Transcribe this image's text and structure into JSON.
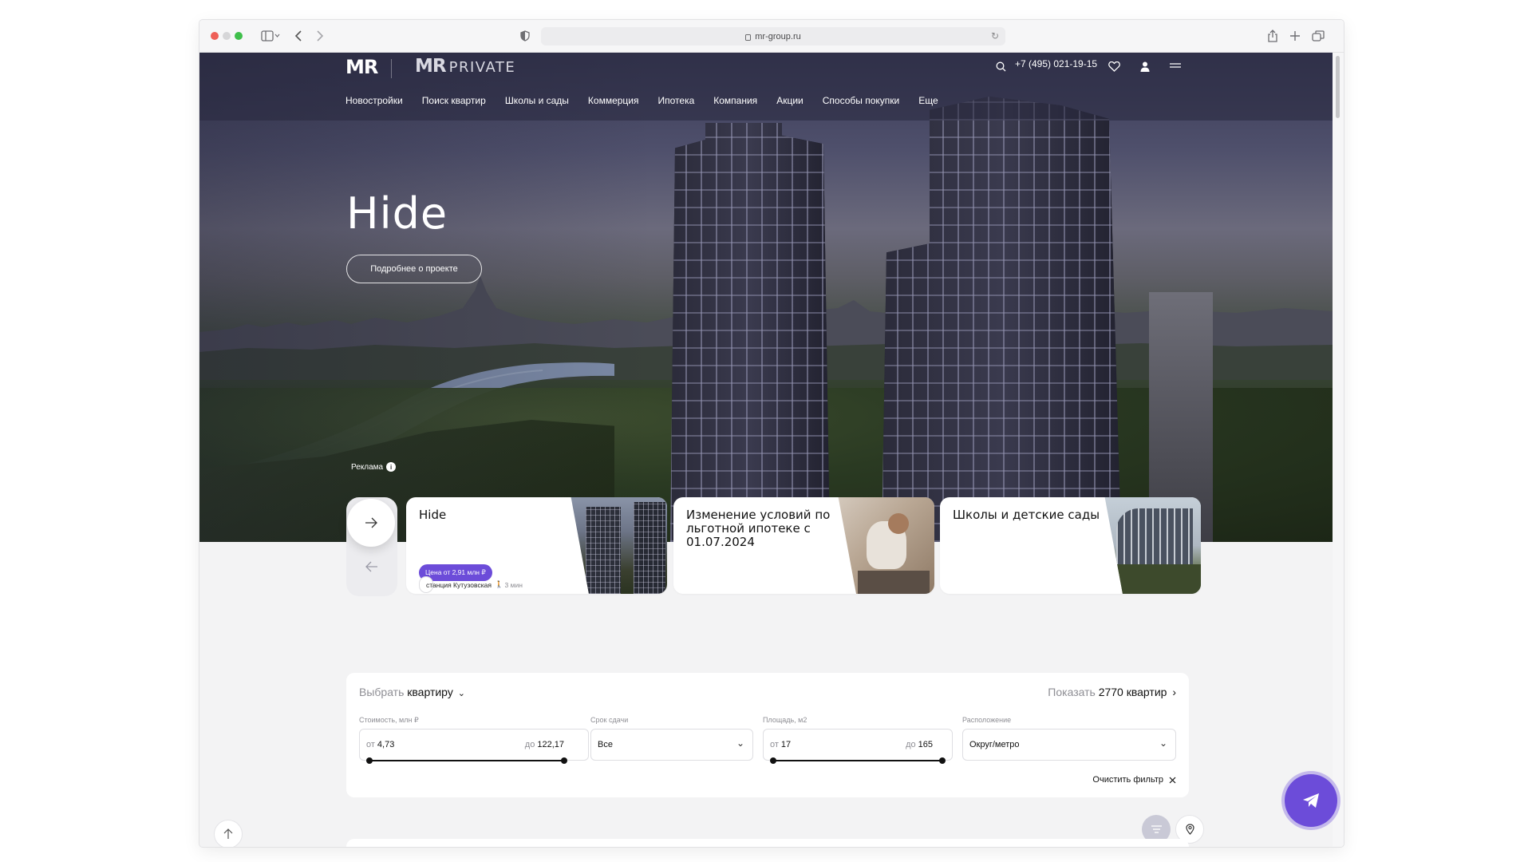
{
  "browser": {
    "url": "mr-group.ru"
  },
  "header": {
    "logo_primary": "MR",
    "logo_secondary_mark": "MR",
    "logo_secondary_text": "PRIVATE",
    "phone": "+7 (495) 021-19-15",
    "nav": [
      "Новостройки",
      "Поиск квартир",
      "Школы и сады",
      "Коммерция",
      "Ипотека",
      "Компания",
      "Акции",
      "Способы покупки",
      "Еще"
    ]
  },
  "hero": {
    "title": "Hide",
    "button": "Подробнее о проекте",
    "ad_label": "Реклама",
    "ad_info": "i"
  },
  "cards": [
    {
      "title": "Hide",
      "station": "станция Кутузовская",
      "walk": "3 мин",
      "price": "Цена от 2,91 млн ₽"
    },
    {
      "title": "Изменение условий по льготной ипотеке с 01.07.2024"
    },
    {
      "title": "Школы и детские сады"
    }
  ],
  "filter": {
    "select_prefix": "Выбрать",
    "select_word": "квартиру",
    "show_prefix": "Показать",
    "show_count": "2770 квартир",
    "price": {
      "label": "Стоимость, млн ₽",
      "from_label": "от",
      "from": "4,73",
      "to_label": "до",
      "to": "122,17"
    },
    "deadline": {
      "label": "Срок сдачи",
      "value": "Все"
    },
    "area": {
      "label": "Площадь, м2",
      "from_label": "от",
      "from": "17",
      "to_label": "до",
      "to": "165"
    },
    "location": {
      "label": "Расположение",
      "value": "Округ/метро"
    },
    "clear": "Очистить фильтр"
  },
  "colors": {
    "accent": "#6c4cd9",
    "hero_sky": "#3a3b57",
    "page_bg": "#f3f3f4"
  }
}
